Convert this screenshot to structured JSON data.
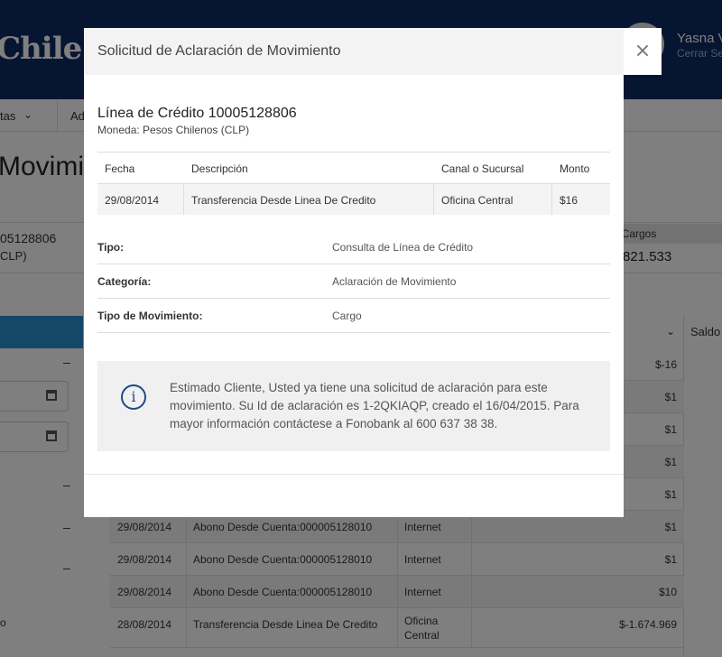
{
  "header": {
    "logo_text": "Chile",
    "user_name": "Yasna V",
    "logout": "Cerrar Se"
  },
  "subnav": {
    "item1": "tas",
    "item2": "Ad"
  },
  "background": {
    "page_title": "Movimie",
    "account_number": "05128806",
    "account_currency": "CLP)",
    "cargos_label": "al Cargos",
    "cargos_value": "821.533",
    "saldo_header": "Saldo",
    "small_text": "o",
    "rows": [
      {
        "date": "",
        "desc": "",
        "channel": "",
        "amount": "$-16"
      },
      {
        "date": "",
        "desc": "",
        "channel": "",
        "amount": "$1"
      },
      {
        "date": "",
        "desc": "",
        "channel": "",
        "amount": "$1"
      },
      {
        "date": "",
        "desc": "",
        "channel": "",
        "amount": "$1"
      },
      {
        "date": "",
        "desc": "",
        "channel": "",
        "amount": "$1"
      },
      {
        "date": "29/08/2014",
        "desc": "Abono Desde Cuenta:000005128010",
        "channel": "Internet",
        "amount": "$1"
      },
      {
        "date": "29/08/2014",
        "desc": "Abono Desde Cuenta:000005128010",
        "channel": "Internet",
        "amount": "$1"
      },
      {
        "date": "29/08/2014",
        "desc": "Abono Desde Cuenta:000005128010",
        "channel": "Internet",
        "amount": "$10"
      },
      {
        "date": "28/08/2014",
        "desc": "Transferencia Desde Linea De Credito",
        "channel": "Oficina Central",
        "amount": "$-1.674.969"
      }
    ]
  },
  "modal": {
    "title": "Solicitud de Aclaración de Movimiento",
    "close_label": "×",
    "credit_title": "Línea de Crédito 10005128806",
    "currency": "Moneda: Pesos Chilenos (CLP)",
    "table": {
      "headers": [
        "Fecha",
        "Descripción",
        "Canal o Sucursal",
        "Monto"
      ],
      "row": [
        "29/08/2014",
        "Transferencia Desde Linea De Credito",
        "Oficina Central",
        "$16"
      ]
    },
    "details": [
      {
        "label": "Tipo:",
        "value": "Consulta de Línea de Crédito"
      },
      {
        "label": "Categoría:",
        "value": "Aclaración de Movimiento"
      },
      {
        "label": "Tipo de Movimiento:",
        "value": "Cargo"
      }
    ],
    "info_icon": "i",
    "info_message": "Estimado Cliente, Usted ya tiene una solicitud de aclaración para este movimiento. Su Id de aclaración es 1-2QKIAQP, creado el 16/04/2015. Para mayor información contáctese a Fonobank al 600 637 38 38."
  }
}
